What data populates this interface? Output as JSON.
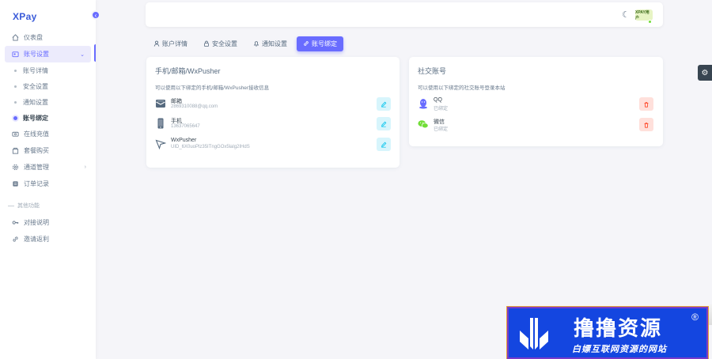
{
  "brand": {
    "name": "XPay",
    "logo_letter": "Y"
  },
  "sidebar": {
    "items": [
      {
        "label": "仪表盘",
        "icon": "home-icon"
      },
      {
        "label": "账号设置",
        "icon": "user-card-icon",
        "open": true
      },
      {
        "label": "在线充值",
        "icon": "wallet-icon"
      },
      {
        "label": "套餐购买",
        "icon": "package-icon"
      },
      {
        "label": "通道管理",
        "icon": "gear-icon"
      },
      {
        "label": "订单记录",
        "icon": "receipt-icon"
      }
    ],
    "subitems": [
      {
        "label": "账号详情"
      },
      {
        "label": "安全设置"
      },
      {
        "label": "通知设置"
      },
      {
        "label": "账号绑定",
        "active": true
      }
    ],
    "section_header": "其他功能",
    "other_items": [
      {
        "label": "对接说明",
        "icon": "key-icon"
      },
      {
        "label": "邀请返利",
        "icon": "link-icon"
      }
    ]
  },
  "navbar": {
    "avatar_text": "XPAY用户"
  },
  "tabs": [
    {
      "label": "账户详情",
      "icon": "user-icon"
    },
    {
      "label": "安全设置",
      "icon": "lock-icon"
    },
    {
      "label": "通知设置",
      "icon": "bell-icon"
    },
    {
      "label": "账号绑定",
      "icon": "link-icon",
      "active": true
    }
  ],
  "card_contact": {
    "title": "手机/邮箱/WxPusher",
    "desc": "可以使用以下绑定的手机/邮箱/WxPusher接收信息",
    "rows": [
      {
        "title": "邮箱",
        "value": "2869310088@qq.com",
        "icon": "mail-icon"
      },
      {
        "title": "手机",
        "value": "13637065647",
        "icon": "phone-icon"
      },
      {
        "title": "WxPusher",
        "value": "UID_6X0uoPlz35ITngGOx5lalg2IHdS",
        "icon": "wxpusher-icon"
      }
    ]
  },
  "card_social": {
    "title": "社交账号",
    "desc": "可以使用以下绑定的社交账号登录本站",
    "rows": [
      {
        "title": "QQ",
        "value": "已绑定",
        "icon": "qq-icon"
      },
      {
        "title": "微信",
        "value": "已绑定",
        "icon": "wechat-icon"
      }
    ]
  },
  "watermark": {
    "title": "撸撸资源",
    "reg": "®",
    "subtitle": "白嫖互联网资源的网站"
  },
  "colors": {
    "primary": "#696cff",
    "info": "#03c3ec",
    "danger": "#ff3e1d",
    "watermark_bg": "#1446e0"
  }
}
